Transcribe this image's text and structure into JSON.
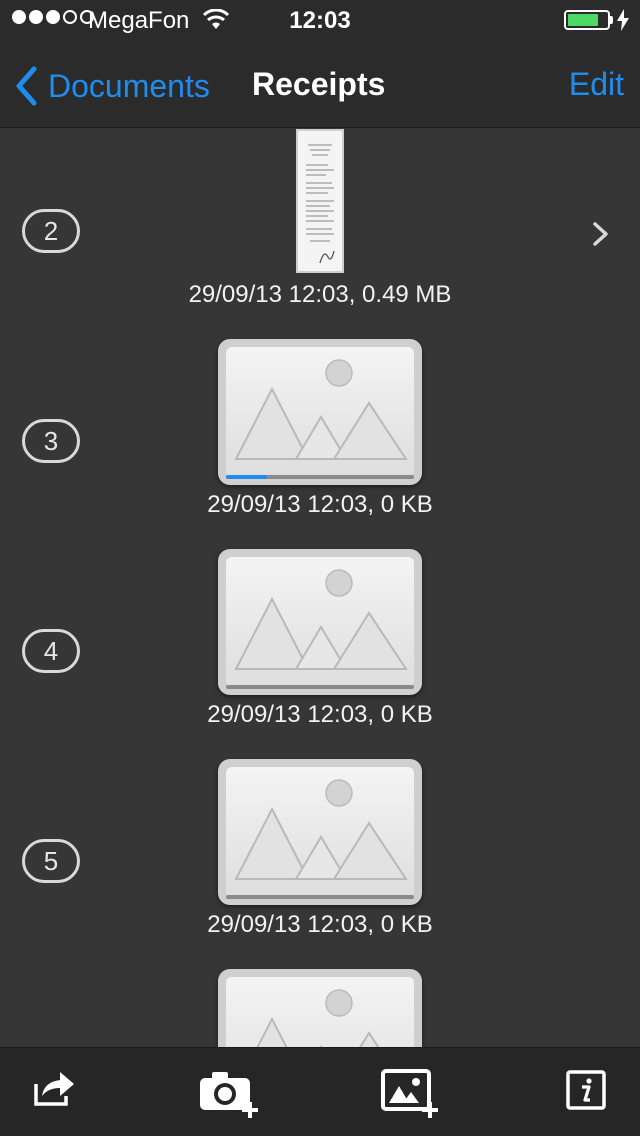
{
  "status_bar": {
    "signal_dots": [
      true,
      true,
      true,
      false,
      false
    ],
    "carrier": "MegaFon",
    "time": "12:03",
    "battery_level": 0.8
  },
  "nav": {
    "back_label": "Documents",
    "title": "Receipts",
    "edit_label": "Edit"
  },
  "items": [
    {
      "index": "2",
      "caption": "29/09/13 12:03, 0.49 MB",
      "thumbnail": "receipt-photo",
      "has_disclosure": true
    },
    {
      "index": "3",
      "caption": "29/09/13 12:03, 0 KB",
      "thumbnail": "placeholder-image",
      "upload_progress": 0.22
    },
    {
      "index": "4",
      "caption": "29/09/13 12:03, 0 KB",
      "thumbnail": "placeholder-image",
      "upload_progress": 0
    },
    {
      "index": "5",
      "caption": "29/09/13 12:03, 0 KB",
      "thumbnail": "placeholder-image",
      "upload_progress": 0
    }
  ],
  "toolbar": {
    "icons": [
      "share-icon",
      "camera-add-icon",
      "photo-add-icon",
      "info-icon"
    ]
  },
  "colors": {
    "accent": "#1f8cf0",
    "background": "#363636",
    "bars": "#2b2b2b",
    "battery": "#4cd964"
  }
}
